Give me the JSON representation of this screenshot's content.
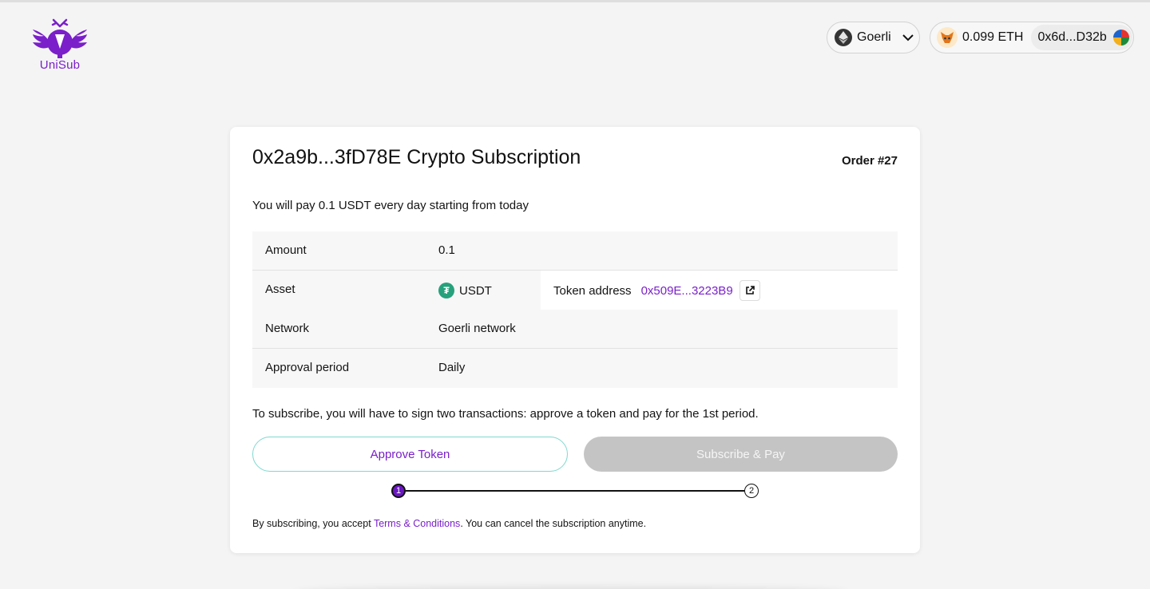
{
  "brand": {
    "name": "UniSub",
    "color": "#7a1fc9"
  },
  "header": {
    "network": {
      "label": "Goerli",
      "icon": "ethereum-icon"
    },
    "wallet": {
      "balance": "0.099 ETH",
      "address": "0x6d...D32b"
    }
  },
  "subscription": {
    "title": "0x2a9b...3fD78E Crypto Subscription",
    "order": "Order #27",
    "description": "You will pay 0.1 USDT every day starting from today",
    "rows": {
      "amount": {
        "label": "Amount",
        "value": "0.1"
      },
      "asset": {
        "label": "Asset",
        "value": "USDT",
        "token_address_label": "Token address",
        "token_address": "0x509E...3223B9"
      },
      "network": {
        "label": "Network",
        "value": "Goerli network"
      },
      "approval": {
        "label": "Approval period",
        "value": "Daily"
      }
    },
    "sign_note": "To subscribe, you will have to sign two transactions: approve a token and pay for the 1st period.",
    "buttons": {
      "approve": "Approve Token",
      "pay": "Subscribe & Pay"
    },
    "steps": [
      "1",
      "2"
    ],
    "terms": {
      "before": "By subscribing, you accept ",
      "link": "Terms & Conditions",
      "after": ". You can cancel the subscription anytime."
    }
  }
}
